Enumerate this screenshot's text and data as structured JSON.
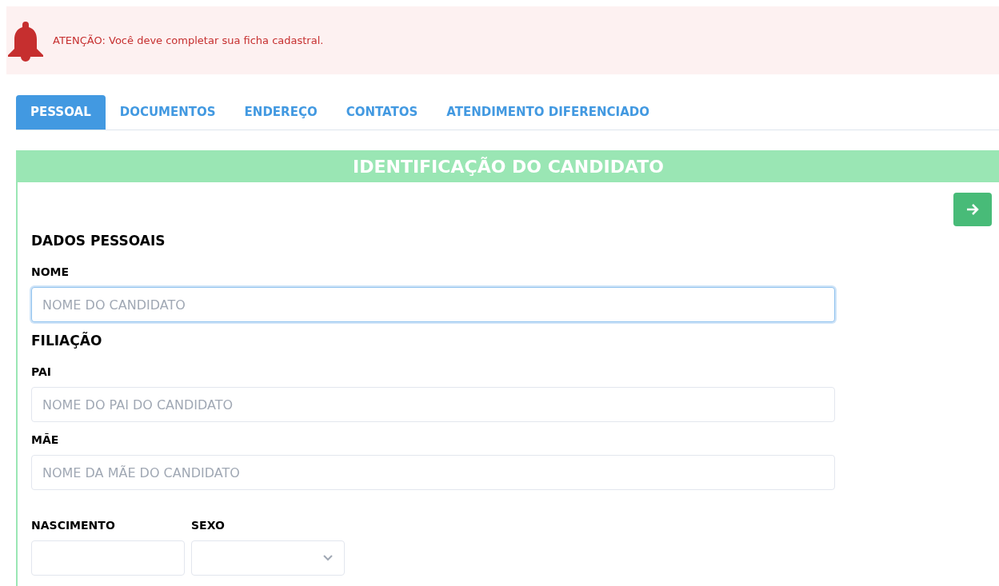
{
  "alert": {
    "text": "ATENÇÃO: Você deve completar sua ficha cadastral."
  },
  "tabs": [
    {
      "label": "PESSOAL",
      "selected": true
    },
    {
      "label": "DOCUMENTOS",
      "selected": false
    },
    {
      "label": "ENDEREÇO",
      "selected": false
    },
    {
      "label": "CONTATOS",
      "selected": false
    },
    {
      "label": "ATENDIMENTO DIFERENCIADO",
      "selected": false
    }
  ],
  "panel": {
    "title": "IDENTIFICAÇÃO DO CANDIDATO",
    "sections": [
      {
        "heading": "DADOS PESSOAIS",
        "rows": [
          [
            {
              "kind": "text",
              "label": "NOME",
              "placeholder": "NOME DO CANDIDATO",
              "focused": true
            }
          ]
        ]
      },
      {
        "heading": "FILIAÇÃO",
        "rows": [
          [
            {
              "kind": "text",
              "label": "PAI",
              "placeholder": "NOME DO PAI DO CANDIDATO",
              "focused": false
            }
          ],
          [
            {
              "kind": "text",
              "label": "MÃE",
              "placeholder": "NOME DA MÃE DO CANDIDATO",
              "focused": false
            }
          ],
          [
            {
              "kind": "date",
              "label": "NASCIMENTO",
              "focused": false
            },
            {
              "kind": "select",
              "label": "SEXO",
              "focused": false
            }
          ]
        ]
      }
    ]
  }
}
